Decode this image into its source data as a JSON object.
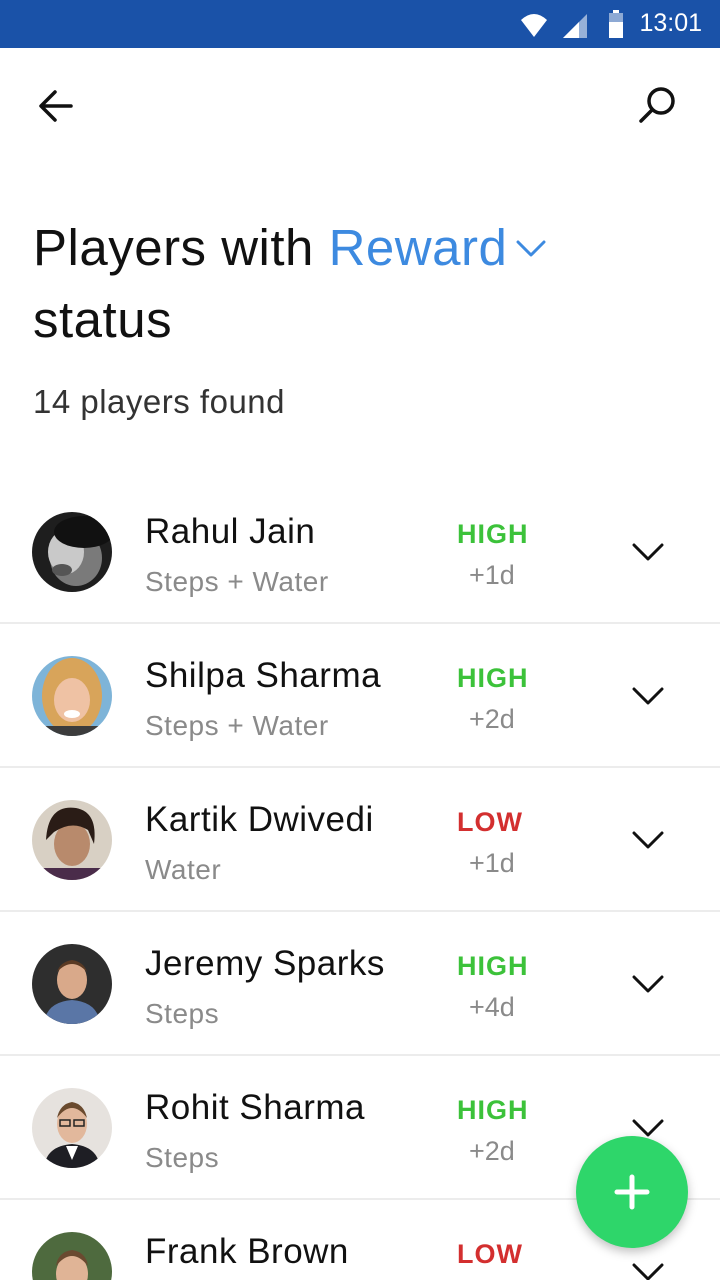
{
  "status_bar": {
    "time": "13:01",
    "icons": [
      "wifi-icon",
      "cell-signal-icon",
      "battery-icon"
    ]
  },
  "app_bar": {
    "back_icon": "arrow-left-icon",
    "search_icon": "search-icon"
  },
  "heading": {
    "prefix": "Players with",
    "filter_value": "Reward",
    "suffix": "status"
  },
  "result_count": "14 players found",
  "colors": {
    "accent": "#3d8ae0",
    "high": "#3cc23a",
    "low": "#d32f2f",
    "fab": "#2ed66a",
    "status_bar": "#1a52a8"
  },
  "players": [
    {
      "name": "Rahul Jain",
      "goal": "Steps + Water",
      "level": "HIGH",
      "days": "+1d"
    },
    {
      "name": "Shilpa Sharma",
      "goal": "Steps + Water",
      "level": "HIGH",
      "days": "+2d"
    },
    {
      "name": "Kartik Dwivedi",
      "goal": "Water",
      "level": "LOW",
      "days": "+1d"
    },
    {
      "name": "Jeremy Sparks",
      "goal": "Steps",
      "level": "HIGH",
      "days": "+4d"
    },
    {
      "name": "Rohit Sharma",
      "goal": "Steps",
      "level": "HIGH",
      "days": "+2d"
    },
    {
      "name": "Frank Brown",
      "goal": "",
      "level": "LOW",
      "days": ""
    }
  ],
  "fab": {
    "icon": "plus-icon"
  }
}
